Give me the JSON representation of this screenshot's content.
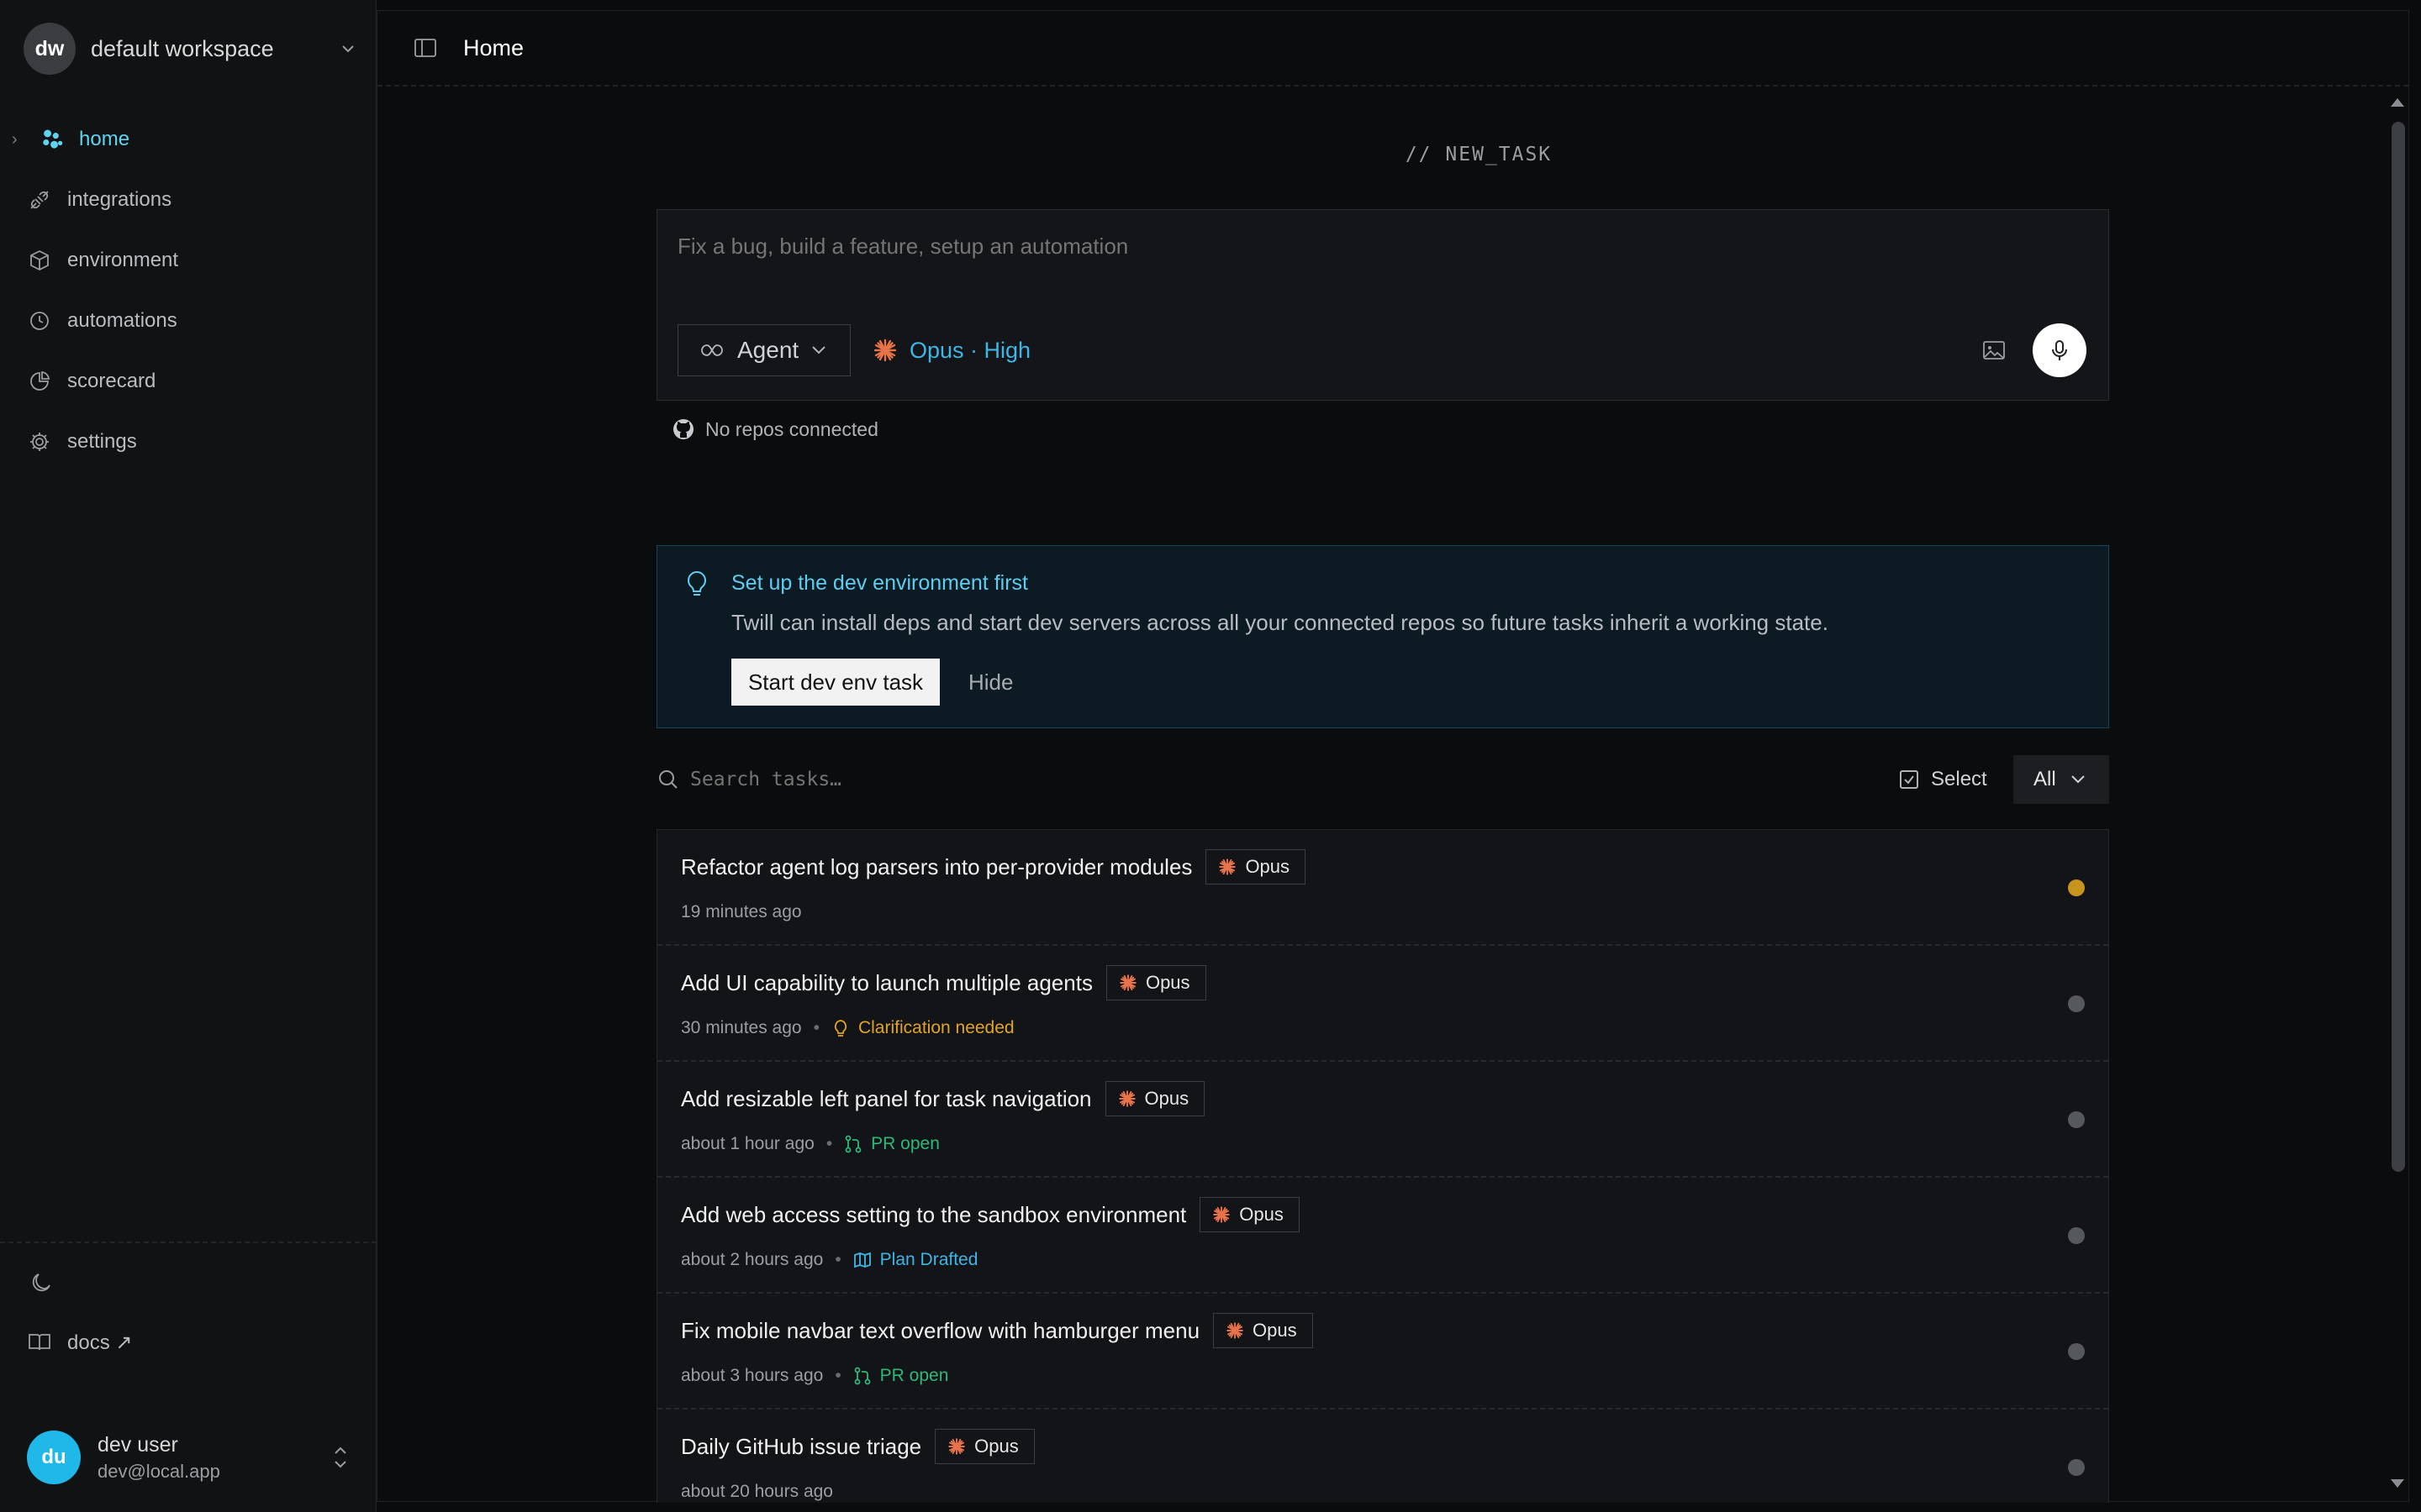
{
  "workspace": {
    "initials": "dw",
    "name": "default workspace"
  },
  "nav": [
    {
      "label": "home",
      "icon": "home-icon",
      "active": true
    },
    {
      "label": "integrations",
      "icon": "plug-icon"
    },
    {
      "label": "environment",
      "icon": "cube-icon"
    },
    {
      "label": "automations",
      "icon": "clock-icon"
    },
    {
      "label": "scorecard",
      "icon": "chart-icon"
    },
    {
      "label": "settings",
      "icon": "gear-icon"
    }
  ],
  "docs_label": "docs ↗",
  "user": {
    "initials": "du",
    "name": "dev user",
    "email": "dev@local.app"
  },
  "header": {
    "title": "Home"
  },
  "new_task": {
    "label": "// NEW_TASK",
    "placeholder": "Fix a bug, build a feature, setup an automation",
    "agent_label": "Agent",
    "model_label": "Opus · High",
    "repos_label": "No repos connected"
  },
  "banner": {
    "title": "Set up the dev environment first",
    "description": "Twill can install deps and start dev servers across all your connected repos so future tasks inherit a working state.",
    "start_label": "Start dev env task",
    "hide_label": "Hide"
  },
  "task_list": {
    "search_placeholder": "Search tasks…",
    "select_label": "Select",
    "filter_label": "All"
  },
  "colors": {
    "accent": "#3fb6e6",
    "opus": "#e8734a",
    "clarification": "#e0a526",
    "pr_open": "#2fb87a",
    "plan_drafted": "#3fb6e6",
    "status_running": "#c8941e",
    "status_idle": "#55585d"
  },
  "tasks": [
    {
      "title": "Refactor agent log parsers into per-provider modules",
      "model": "Opus",
      "time": "19 minutes ago",
      "status": "",
      "status_icon": "",
      "dot": "running"
    },
    {
      "title": "Add UI capability to launch multiple agents",
      "model": "Opus",
      "time": "30 minutes ago",
      "status": "Clarification needed",
      "status_icon": "bulb-icon",
      "dot": "idle"
    },
    {
      "title": "Add resizable left panel for task navigation",
      "model": "Opus",
      "time": "about 1 hour ago",
      "status": "PR open",
      "status_icon": "pull-request-icon",
      "dot": "idle"
    },
    {
      "title": "Add web access setting to the sandbox environment",
      "model": "Opus",
      "time": "about 2 hours ago",
      "status": "Plan Drafted",
      "status_icon": "map-icon",
      "dot": "idle"
    },
    {
      "title": "Fix mobile navbar text overflow with hamburger menu",
      "model": "Opus",
      "time": "about 3 hours ago",
      "status": "PR open",
      "status_icon": "pull-request-icon",
      "dot": "idle"
    },
    {
      "title": "Daily GitHub issue triage",
      "model": "Opus",
      "time": "about 20 hours ago",
      "status": "",
      "status_icon": "",
      "dot": "idle"
    }
  ]
}
